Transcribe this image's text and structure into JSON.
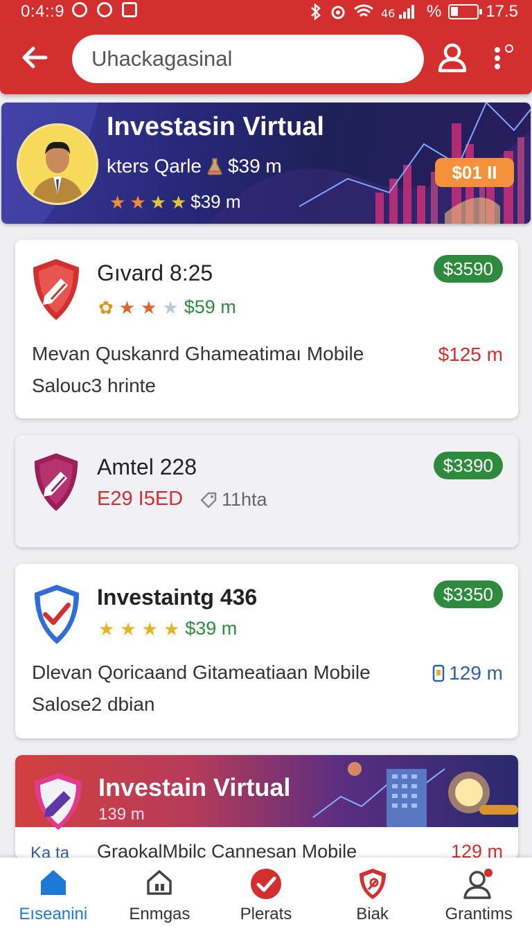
{
  "status_bar": {
    "time": "0:4::9",
    "battery_text": "17.5",
    "signal_text": "%"
  },
  "search": {
    "value": "Uhackagasinal"
  },
  "hero": {
    "title": "Investasin Virtual",
    "subtitle": "kters Qarle",
    "subtitle_price": "$39 m",
    "rating_price": "$39 m",
    "rating": 4,
    "badge": "$01 II"
  },
  "cards": [
    {
      "name": "Gıvard 8:25",
      "stars": 3,
      "price_text": "$59 m",
      "badge": "$3590",
      "desc_line1": "Mevan Quskanrd Ghameatimaı Mobile",
      "desc_line2": "Salouc3 hrinte",
      "side_value": "$125 m"
    },
    {
      "name": "Amtel 228",
      "code": "E29 I5ED",
      "tag": "11hta",
      "badge": "$3390"
    },
    {
      "name": "Investaintg 436",
      "stars": 4,
      "price_text": "$39 m",
      "badge": "$3350",
      "desc_line1": "Dlevan Qoricaand Gitameatiaan Mobile",
      "desc_line2": "Salose2 dbian",
      "side_value": "129 m"
    }
  ],
  "promo": {
    "title": "Investain Virtual",
    "subtitle": "139 m",
    "row_text": "GraokalMbilc Cannesan Mobile",
    "row_value": "129 m",
    "row_left": "Ka ta"
  },
  "nav": [
    {
      "label": "Eıseanini",
      "active": true
    },
    {
      "label": "Enmgas"
    },
    {
      "label": "Plerats"
    },
    {
      "label": "Biak"
    },
    {
      "label": "Grantims"
    }
  ],
  "colors": {
    "primary": "#d32f2f",
    "success": "#2e8b3e",
    "accent": "#1e78d6",
    "star": "#e6b422"
  }
}
